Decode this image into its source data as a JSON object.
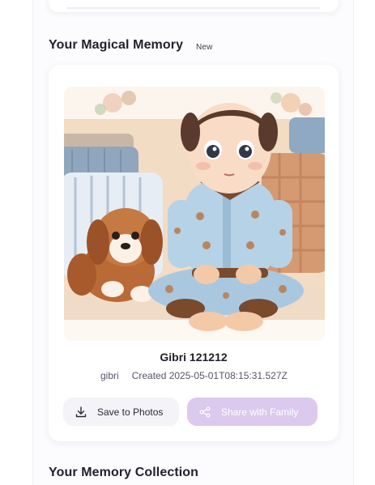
{
  "sections": {
    "magical_title": "Your Magical Memory",
    "magical_badge": "New",
    "collection_title": "Your Memory Collection"
  },
  "memory": {
    "title": "Gibri 121212",
    "author": "gibri",
    "created": "Created 2025-05-01T08:15:31.527Z",
    "image_alt": "Watercolor illustration of a boy in blue pajamas sitting cross-legged on a sofa beside a fluffy brown puppy"
  },
  "actions": {
    "save_label": "Save to Photos",
    "share_label": "Share with Family"
  },
  "icons": {
    "save": "download-icon",
    "share": "share-icon"
  },
  "colors": {
    "share_button_bg": "#dcc9ee",
    "save_button_bg": "#f4f4f8",
    "title_text": "#22222e"
  }
}
